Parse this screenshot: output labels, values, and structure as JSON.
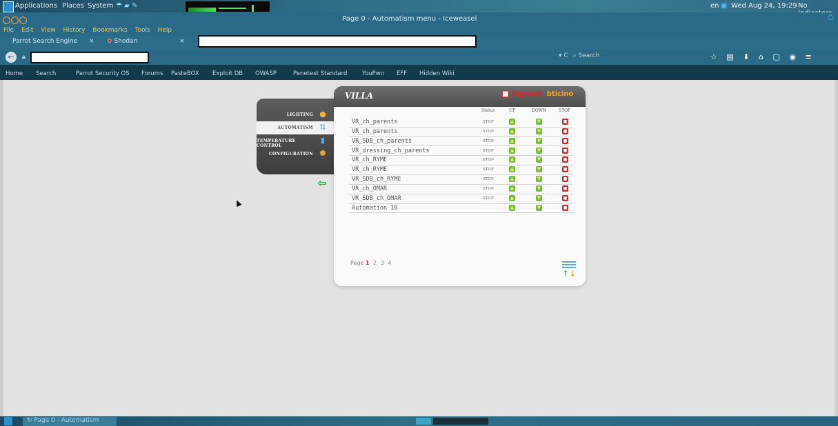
{
  "system_panel": {
    "menus": [
      "Applications",
      "Places",
      "System"
    ],
    "locale": "en",
    "datetime": "Wed Aug 24, 19:29",
    "indicators": "No Indicators"
  },
  "window": {
    "title": "Page 0 - Automatism menu - Iceweasel"
  },
  "menubar": [
    "File",
    "Edit",
    "View",
    "History",
    "Bookmarks",
    "Tools",
    "Help"
  ],
  "tabs": [
    {
      "label": "Parrot Search Engine",
      "close": "×"
    },
    {
      "label": "Shodan",
      "close": "×"
    }
  ],
  "navbar": {
    "search_placeholder": "Search",
    "reload": "▾ C"
  },
  "bookmarks": [
    "Home",
    "Search",
    "Parrot Security OS",
    "Forums",
    "PasteBOX",
    "Exploit DB",
    "OWASP",
    "Penetest Standard",
    "YouPwn",
    "EFF",
    "Hidden Wiki"
  ],
  "app": {
    "title": "VILLA",
    "brand_left": "legrand",
    "brand_right": "bticino",
    "nav": [
      {
        "label": "LIGHTING",
        "icon": "lightbulb-icon"
      },
      {
        "label": "AUTOMATISM",
        "icon": "automatism-icon"
      },
      {
        "label": "TEMPERATURE CONTROL",
        "icon": "thermometer-icon"
      },
      {
        "label": "CONFIGURATION",
        "icon": "gear-icon"
      }
    ],
    "columns": {
      "status": "Status",
      "up": "UP",
      "down": "DOWN",
      "stop": "STOP"
    },
    "rows": [
      {
        "name": "VR_ch_parents",
        "status": "STOP"
      },
      {
        "name": "VR_ch_parents",
        "status": "STOP"
      },
      {
        "name": "VR_SDB_ch_parents",
        "status": "STOP"
      },
      {
        "name": "VR_dressing_ch_parents",
        "status": "STOP"
      },
      {
        "name": "VR_ch_RYME",
        "status": "STOP"
      },
      {
        "name": "VR_ch_RYME",
        "status": "STOP"
      },
      {
        "name": "VR_SDB_ch_RYME",
        "status": "STOP"
      },
      {
        "name": "VR_ch_OMAR",
        "status": "STOP"
      },
      {
        "name": "VR_SDB_ch_OMAR",
        "status": "STOP"
      },
      {
        "name": "Automation 10",
        "status": ""
      }
    ],
    "pager": {
      "label": "Page",
      "current": "1",
      "pages": [
        "2",
        "3",
        "4"
      ]
    }
  },
  "taskbar": {
    "item": "Page 0 - Automatism"
  }
}
